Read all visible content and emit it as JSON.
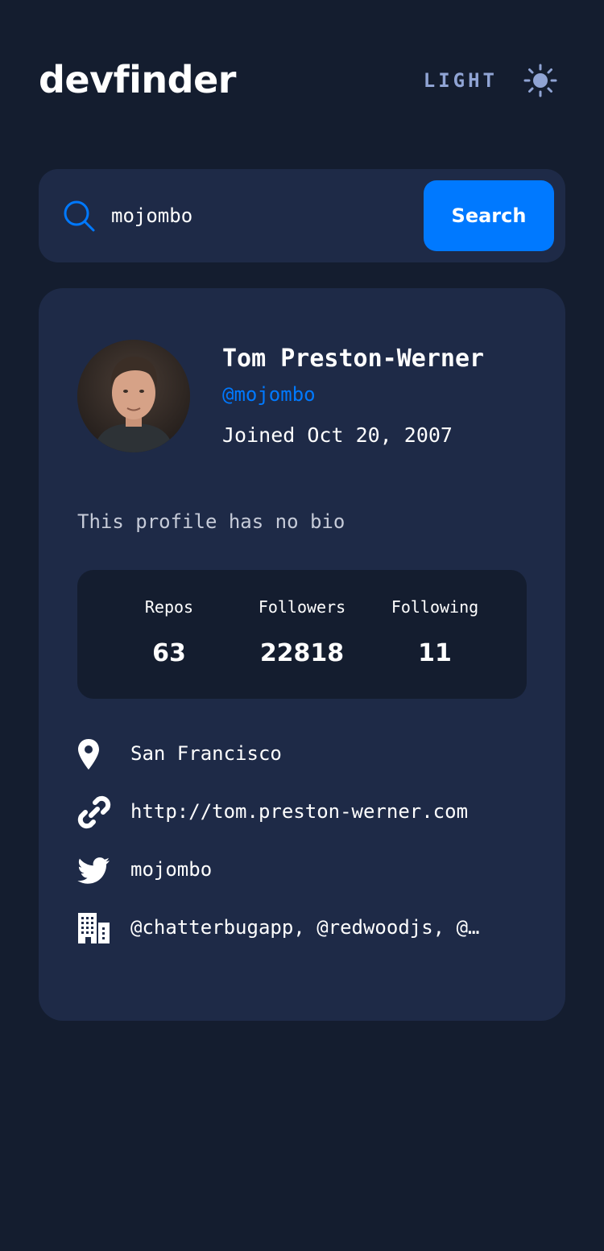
{
  "app": {
    "logo": "devfinder"
  },
  "theme_toggle": {
    "label": "LIGHT",
    "icon": "sun-icon"
  },
  "search": {
    "value": "mojombo",
    "button_label": "Search",
    "icon": "search-icon"
  },
  "profile": {
    "name": "Tom Preston-Werner",
    "login": "@mojombo",
    "joined": "Joined Oct 20, 2007",
    "bio": "This profile has no bio"
  },
  "stats": {
    "repos_label": "Repos",
    "repos_value": "63",
    "followers_label": "Followers",
    "followers_value": "22818",
    "following_label": "Following",
    "following_value": "11"
  },
  "links": {
    "location": "San Francisco",
    "website": "http://tom.preston-werner.com",
    "twitter": "mojombo",
    "company": "@chatterbugapp, @redwoodjs, @…"
  },
  "colors": {
    "background": "#141d2f",
    "card": "#1e2a47",
    "accent": "#0079ff",
    "muted": "#90a4d4"
  }
}
